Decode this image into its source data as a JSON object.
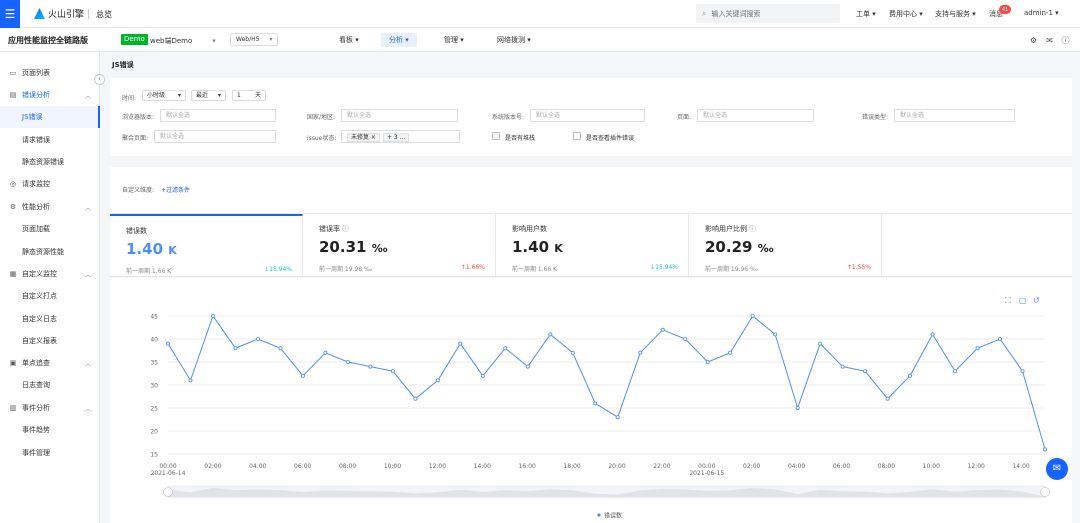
{
  "topbar": {
    "brand": "火山引擎",
    "title": "总览",
    "search_placeholder": "输入关键词搜索",
    "nav": [
      "工单",
      "费用中心",
      "支持与服务",
      "消息"
    ],
    "msg_count": "41",
    "user": "admin-1"
  },
  "subbar": {
    "app_title": "应用性能监控全链路版",
    "demo_tag": "Demo",
    "app_name": "web端Demo",
    "platform": "Web/H5",
    "tabs": [
      "看板",
      "分析",
      "管理",
      "网络拨测"
    ]
  },
  "sidebar": {
    "items": [
      {
        "label": "页面列表",
        "icon": "monitor-icon"
      },
      {
        "label": "错误分析",
        "icon": "bug-icon"
      },
      {
        "label": "JS错误"
      },
      {
        "label": "请求错误"
      },
      {
        "label": "静态资源错误"
      },
      {
        "label": "请求监控",
        "icon": "request-icon"
      },
      {
        "label": "性能分析",
        "icon": "performance-icon"
      },
      {
        "label": "页面加载"
      },
      {
        "label": "静态资源性能"
      },
      {
        "label": "自定义监控",
        "icon": "custom-icon"
      },
      {
        "label": "自定义打点"
      },
      {
        "label": "自定义日志"
      },
      {
        "label": "自定义报表"
      },
      {
        "label": "单点追查",
        "icon": "trace-icon"
      },
      {
        "label": "日志查询"
      },
      {
        "label": "事件分析",
        "icon": "event-icon"
      },
      {
        "label": "事件趋势"
      },
      {
        "label": "事件管理"
      }
    ]
  },
  "page": {
    "title": "JS错误"
  },
  "filters": {
    "time_label": "时间:",
    "granularity": "小时级",
    "recent": "最近",
    "amount": "1",
    "unit": "天",
    "browser_label": "浏览器版本:",
    "region_label": "国家/地区:",
    "os_label": "系统版本号:",
    "page_label": "页面:",
    "error_type_label": "错误类型:",
    "agg_page_label": "聚合页面:",
    "issue_label": "issue状态:",
    "issue_chip": "未修复",
    "issue_more": "+ 3 ...",
    "placeholder": "默认全选",
    "stack_check": "是否有堆栈",
    "plugin_check": "是否查看插件错误"
  },
  "custom": {
    "label": "自定义维度:",
    "add": "+过滤条件"
  },
  "metrics": [
    {
      "name": "错误数",
      "value": "1.40",
      "unit": "K",
      "prev": "前一周期 1.66 K",
      "delta": "↓15.94%",
      "dir": "down"
    },
    {
      "name": "错误率",
      "value": "20.31",
      "unit": "‰",
      "prev": "前一周期 19.98 ‰",
      "delta": "↑1.66%",
      "dir": "up"
    },
    {
      "name": "影响用户数",
      "value": "1.40",
      "unit": "K",
      "prev": "前一周期 1.66 K",
      "delta": "↓15.94%",
      "dir": "down"
    },
    {
      "name": "影响用户比例",
      "value": "20.29",
      "unit": "‰",
      "prev": "前一周期 19.96 ‰",
      "delta": "↑1.55%",
      "dir": "up"
    }
  ],
  "chart_data": {
    "type": "line",
    "ylim": [
      15,
      45
    ],
    "yticks": [
      15,
      20,
      25,
      30,
      35,
      40,
      45
    ],
    "xticks": [
      {
        "t": "00:00",
        "d": "2021-06-14"
      },
      {
        "t": "02:00"
      },
      {
        "t": "04:00"
      },
      {
        "t": "06:00"
      },
      {
        "t": "08:00"
      },
      {
        "t": "10:00"
      },
      {
        "t": "12:00"
      },
      {
        "t": "14:00"
      },
      {
        "t": "16:00"
      },
      {
        "t": "18:00"
      },
      {
        "t": "20:00"
      },
      {
        "t": "22:00"
      },
      {
        "t": "00:00",
        "d": "2021-06-15"
      },
      {
        "t": "02:00"
      },
      {
        "t": "04:00"
      },
      {
        "t": "06:00"
      },
      {
        "t": "08:00"
      },
      {
        "t": "10:00"
      },
      {
        "t": "12:00"
      },
      {
        "t": "14:00"
      }
    ],
    "series": [
      {
        "name": "错误数",
        "color": "#4f8ef7",
        "values": [
          39,
          31,
          45,
          38,
          40,
          38,
          32,
          37,
          35,
          34,
          33,
          27,
          31,
          39,
          32,
          38,
          34,
          41,
          37,
          26,
          23,
          37,
          42,
          40,
          35,
          37,
          45,
          41,
          25,
          39,
          34,
          33,
          27,
          32,
          41,
          33,
          38,
          40,
          33,
          16
        ]
      }
    ],
    "legend": "bottom"
  },
  "colors": {
    "primary": "#1664ff",
    "line": "#4f8ef7",
    "up": "#f54a45",
    "down": "#14c9c9"
  }
}
